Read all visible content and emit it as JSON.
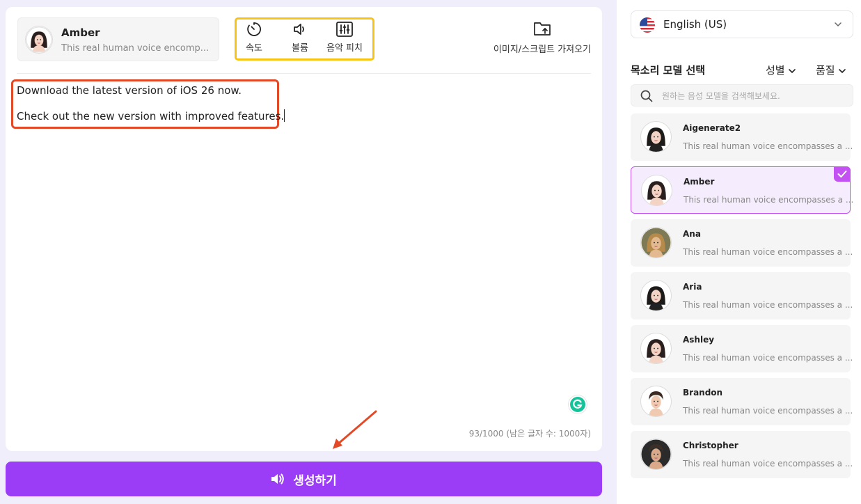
{
  "editor": {
    "voice": {
      "name": "Amber",
      "description": "This real human voice encomp..."
    },
    "controls": [
      {
        "label": "속도",
        "icon": "speed-icon"
      },
      {
        "label": "볼륨",
        "icon": "volume-icon"
      },
      {
        "label": "음악 피치",
        "icon": "pitch-icon"
      }
    ],
    "import_label": "이미지/스크립트 가져오기",
    "text_lines": [
      "Download the latest version of iOS 26 now.",
      "Check out the new version with improved features."
    ],
    "counter": "93/1000 (남은 글자 수: 1000자)",
    "generate_label": "생성하기"
  },
  "right_panel": {
    "language": "English (US)",
    "section_title": "목소리 모델 선택",
    "filters": [
      "성별",
      "품질"
    ],
    "search_placeholder": "원하는 음성 모델을 검색해보세요.",
    "voices": [
      {
        "name": "Aigenerate2",
        "description": "This real human voice encompasses a ...",
        "selected": false
      },
      {
        "name": "Amber",
        "description": "This real human voice encompasses a ...",
        "selected": true
      },
      {
        "name": "Ana",
        "description": "This real human voice encompasses a ...",
        "selected": false
      },
      {
        "name": "Aria",
        "description": "This real human voice encompasses a ...",
        "selected": false
      },
      {
        "name": "Ashley",
        "description": "This real human voice encompasses a ...",
        "selected": false
      },
      {
        "name": "Brandon",
        "description": "This real human voice encompasses a ...",
        "selected": false
      },
      {
        "name": "Christopher",
        "description": "This real human voice encompasses a ...",
        "selected": false
      }
    ]
  },
  "colors": {
    "accent": "#9b3df7",
    "selected_border": "#c452f2",
    "controls_highlight": "#f6c316",
    "text_highlight": "#e24a27",
    "annotation_arrow": "#e24a27"
  }
}
